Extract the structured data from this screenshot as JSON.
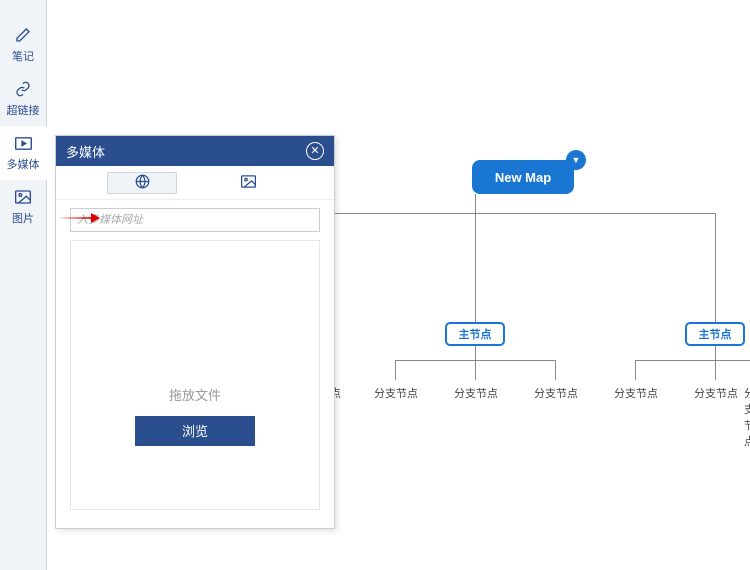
{
  "sidebar": {
    "items": [
      {
        "label": "笔记",
        "name": "sidebar-item-note"
      },
      {
        "label": "超链接",
        "name": "sidebar-item-hyperlink"
      },
      {
        "label": "多媒体",
        "name": "sidebar-item-multimedia"
      },
      {
        "label": "图片",
        "name": "sidebar-item-image"
      }
    ]
  },
  "panel": {
    "title": "多媒体",
    "input_placeholder": "入多媒体网址",
    "drop_label": "拖放文件",
    "browse_label": "浏览"
  },
  "map": {
    "root": "New Map",
    "main_left": "主节点",
    "main_right": "主节点",
    "branch": "分支节点",
    "branch_partial": "点"
  }
}
